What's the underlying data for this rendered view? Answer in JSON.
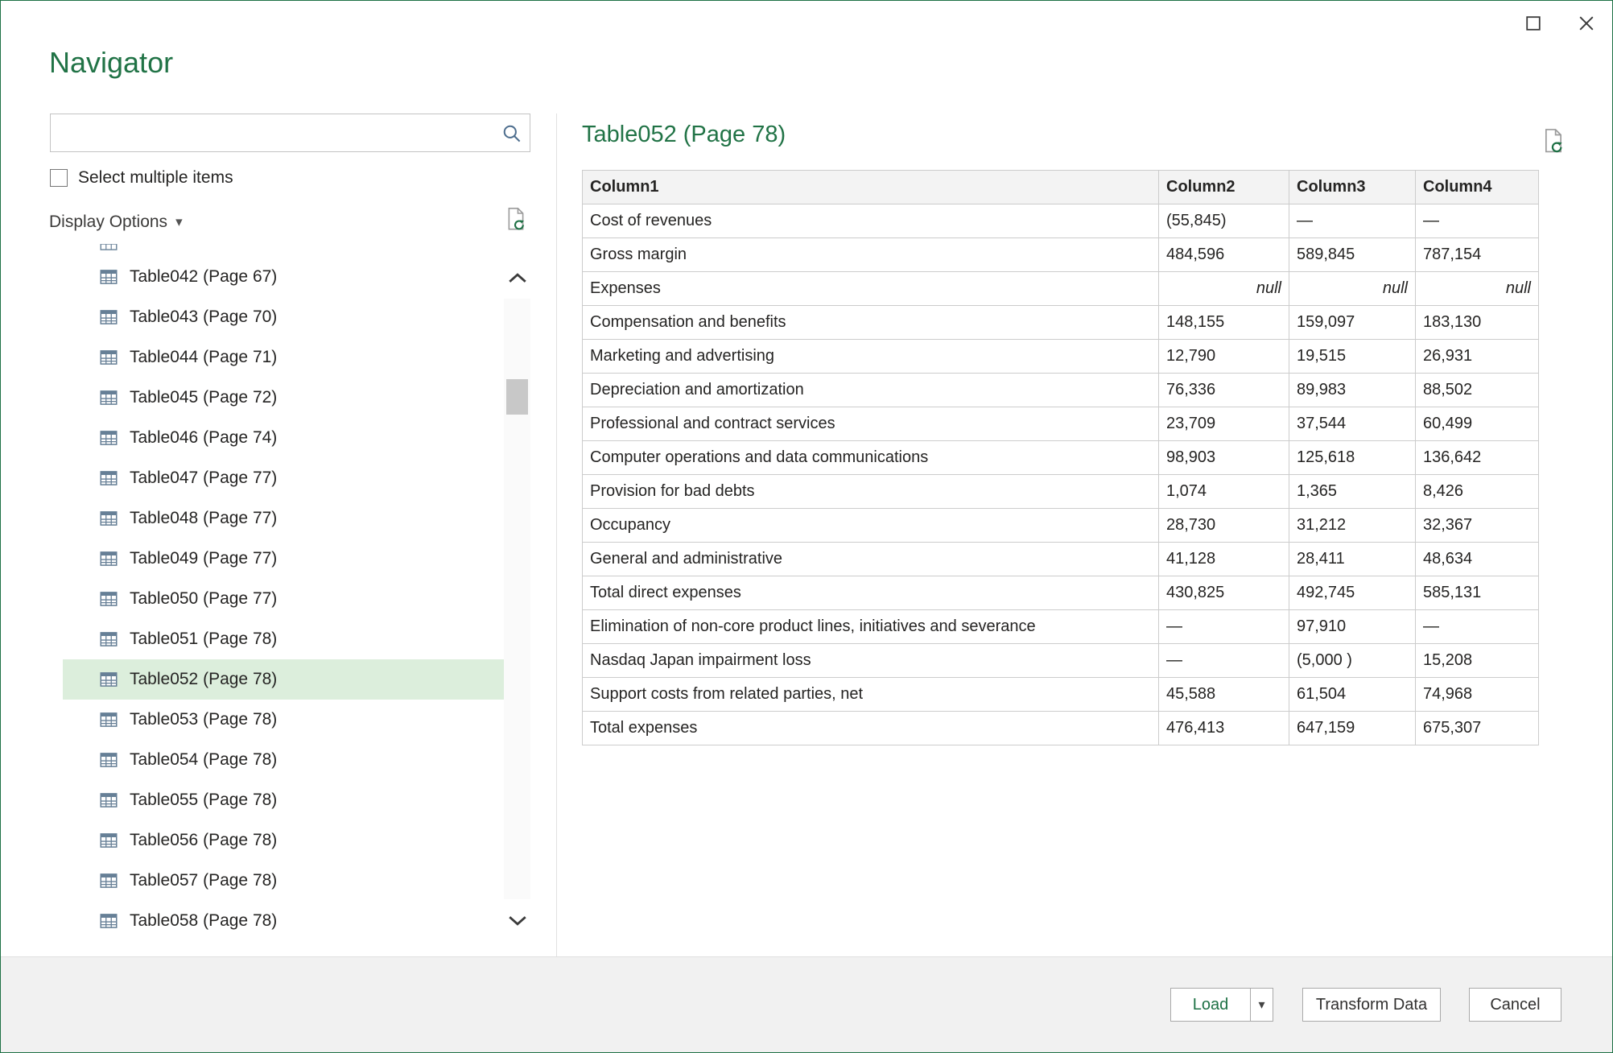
{
  "window": {
    "title": "Navigator"
  },
  "icons": {
    "caret": "▾"
  },
  "left": {
    "search": {
      "value": ""
    },
    "select_multiple_label": "Select multiple items",
    "display_options_label": "Display Options",
    "items": [
      {
        "label": "Table042 (Page 67)"
      },
      {
        "label": "Table043 (Page 70)"
      },
      {
        "label": "Table044 (Page 71)"
      },
      {
        "label": "Table045 (Page 72)"
      },
      {
        "label": "Table046 (Page 74)"
      },
      {
        "label": "Table047 (Page 77)"
      },
      {
        "label": "Table048 (Page 77)"
      },
      {
        "label": "Table049 (Page 77)"
      },
      {
        "label": "Table050 (Page 77)"
      },
      {
        "label": "Table051 (Page 78)"
      },
      {
        "label": "Table052 (Page 78)",
        "selected": true
      },
      {
        "label": "Table053 (Page 78)"
      },
      {
        "label": "Table054 (Page 78)"
      },
      {
        "label": "Table055 (Page 78)"
      },
      {
        "label": "Table056 (Page 78)"
      },
      {
        "label": "Table057 (Page 78)"
      },
      {
        "label": "Table058 (Page 78)"
      }
    ]
  },
  "preview": {
    "title": "Table052 (Page 78)",
    "table": {
      "columns": [
        "Column1",
        "Column2",
        "Column3",
        "Column4"
      ],
      "rows": [
        [
          "Cost of revenues",
          "(55,845)",
          "—",
          "—"
        ],
        [
          "Gross margin",
          "484,596",
          "589,845",
          "787,154"
        ],
        [
          "Expenses",
          "null",
          "null",
          "null"
        ],
        [
          "Compensation and benefits",
          "148,155",
          "159,097",
          "183,130"
        ],
        [
          "Marketing and advertising",
          "12,790",
          "19,515",
          "26,931"
        ],
        [
          "Depreciation and amortization",
          "76,336",
          "89,983",
          "88,502"
        ],
        [
          "Professional and contract services",
          "23,709",
          "37,544",
          "60,499"
        ],
        [
          "Computer operations and data communications",
          "98,903",
          "125,618",
          "136,642"
        ],
        [
          "Provision for bad debts",
          "1,074",
          "1,365",
          "8,426"
        ],
        [
          "Occupancy",
          "28,730",
          "31,212",
          "32,367"
        ],
        [
          "General and administrative",
          "41,128",
          "28,411",
          "48,634"
        ],
        [
          "Total direct expenses",
          "430,825",
          "492,745",
          "585,131"
        ],
        [
          "Elimination of non-core product lines, initiatives and severance",
          "—",
          "97,910",
          "—"
        ],
        [
          "Nasdaq Japan impairment loss",
          "—",
          "(5,000 )",
          "15,208"
        ],
        [
          "Support costs from related parties, net",
          "45,588",
          "61,504",
          "74,968"
        ],
        [
          "Total expenses",
          "476,413",
          "647,159",
          "675,307"
        ]
      ]
    }
  },
  "footer": {
    "load_label": "Load",
    "transform_label": "Transform Data",
    "cancel_label": "Cancel"
  }
}
